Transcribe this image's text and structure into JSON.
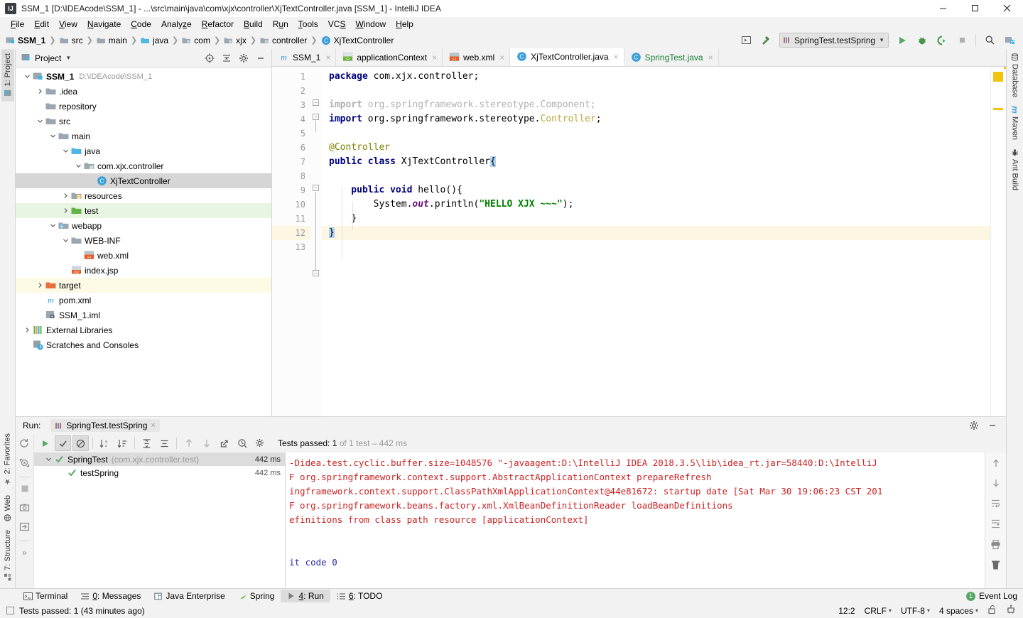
{
  "window": {
    "title": "SSM_1 [D:\\IDEAcode\\SSM_1] - ...\\src\\main\\java\\com\\xjx\\controller\\XjTextController.java [SSM_1] - IntelliJ IDEA",
    "icon": "intellij-logo-icon",
    "minimize_label": "Minimize",
    "maximize_label": "Maximize",
    "close_label": "Close"
  },
  "menubar": {
    "items": [
      {
        "label": "File",
        "mnemonic": "F"
      },
      {
        "label": "Edit",
        "mnemonic": "E"
      },
      {
        "label": "View",
        "mnemonic": "V"
      },
      {
        "label": "Navigate",
        "mnemonic": "N"
      },
      {
        "label": "Code",
        "mnemonic": "C"
      },
      {
        "label": "Analyze",
        "mnemonic": "z"
      },
      {
        "label": "Refactor",
        "mnemonic": "R"
      },
      {
        "label": "Build",
        "mnemonic": "B"
      },
      {
        "label": "Run",
        "mnemonic": "u"
      },
      {
        "label": "Tools",
        "mnemonic": "T"
      },
      {
        "label": "VCS",
        "mnemonic": "S"
      },
      {
        "label": "Window",
        "mnemonic": "W"
      },
      {
        "label": "Help",
        "mnemonic": "H"
      }
    ]
  },
  "navbar": {
    "breadcrumbs": [
      {
        "label": "SSM_1",
        "icon": "project-module-icon",
        "bold": true
      },
      {
        "label": "src",
        "icon": "folder-icon",
        "bold": false
      },
      {
        "label": "main",
        "icon": "folder-icon",
        "bold": false
      },
      {
        "label": "java",
        "icon": "source-folder-icon",
        "bold": false
      },
      {
        "label": "com",
        "icon": "package-icon",
        "bold": false
      },
      {
        "label": "xjx",
        "icon": "package-icon",
        "bold": false
      },
      {
        "label": "controller",
        "icon": "package-icon",
        "bold": false
      },
      {
        "label": "XjTextController",
        "icon": "java-class-icon",
        "bold": false
      }
    ],
    "separator": "›",
    "run_config": "SpringTest.testSpring",
    "buttons": [
      {
        "name": "select-run-configuration-icon",
        "title": "Select Run/Debug Configuration"
      },
      {
        "name": "build-hammer-icon",
        "title": "Build Project"
      },
      {
        "name": "run-button-icon",
        "title": "Run"
      },
      {
        "name": "debug-button-icon",
        "title": "Debug"
      },
      {
        "name": "run-with-coverage-icon",
        "title": "Run with Coverage"
      },
      {
        "name": "stop-button-icon",
        "title": "Stop"
      },
      {
        "name": "search-everywhere-icon",
        "title": "Search Everywhere"
      },
      {
        "name": "project-structure-icon",
        "title": "Project Structure"
      }
    ]
  },
  "left_stripe": {
    "top": [
      {
        "label": "1: Project",
        "mnemonic": "1",
        "active": true
      }
    ],
    "bottom": [
      {
        "label": "2: Favorites",
        "mnemonic": "2",
        "active": false
      },
      {
        "label": "Web",
        "mnemonic": "",
        "active": false
      },
      {
        "label": "7: Structure",
        "mnemonic": "7",
        "active": false
      }
    ]
  },
  "right_stripe": {
    "items": [
      {
        "label": "Database",
        "icon": "database-icon"
      },
      {
        "label": "Maven",
        "icon": "maven-icon"
      },
      {
        "label": "Ant Build",
        "icon": "ant-icon"
      }
    ]
  },
  "project_panel": {
    "title": "Project",
    "dropdown_caret": "▾",
    "actions": [
      {
        "name": "scroll-from-source-icon",
        "title": "Select Opened File"
      },
      {
        "name": "collapse-all-icon",
        "title": "Collapse All"
      },
      {
        "name": "settings-gear-icon",
        "title": "Settings"
      },
      {
        "name": "hide-panel-icon",
        "title": "Hide"
      }
    ],
    "tree": [
      {
        "label": "SSM_1",
        "path": "D:\\IDEAcode\\SSM_1",
        "depth": 0,
        "arrow": "down",
        "icon": "project-root-icon",
        "bold": true,
        "state": "none"
      },
      {
        "label": ".idea",
        "path": "",
        "depth": 1,
        "arrow": "right",
        "icon": "folder-icon",
        "bold": false,
        "state": "none"
      },
      {
        "label": "repository",
        "path": "",
        "depth": 1,
        "arrow": "none",
        "icon": "folder-icon",
        "bold": false,
        "state": "none"
      },
      {
        "label": "src",
        "path": "",
        "depth": 1,
        "arrow": "down",
        "icon": "folder-icon",
        "bold": false,
        "state": "none"
      },
      {
        "label": "main",
        "path": "",
        "depth": 2,
        "arrow": "down",
        "icon": "folder-icon",
        "bold": false,
        "state": "none"
      },
      {
        "label": "java",
        "path": "",
        "depth": 3,
        "arrow": "down",
        "icon": "source-folder-icon",
        "bold": false,
        "state": "none"
      },
      {
        "label": "com.xjx.controller",
        "path": "",
        "depth": 4,
        "arrow": "down",
        "icon": "package-icon",
        "bold": false,
        "state": "none"
      },
      {
        "label": "XjTextController",
        "path": "",
        "depth": 5,
        "arrow": "none",
        "icon": "java-class-icon",
        "bold": false,
        "state": "selected"
      },
      {
        "label": "resources",
        "path": "",
        "depth": 3,
        "arrow": "right",
        "icon": "resource-folder-icon",
        "bold": false,
        "state": "none"
      },
      {
        "label": "test",
        "path": "",
        "depth": 3,
        "arrow": "right",
        "icon": "test-folder-icon",
        "bold": false,
        "state": "green"
      },
      {
        "label": "webapp",
        "path": "",
        "depth": 2,
        "arrow": "down",
        "icon": "web-folder-icon",
        "bold": false,
        "state": "none"
      },
      {
        "label": "WEB-INF",
        "path": "",
        "depth": 3,
        "arrow": "down",
        "icon": "folder-icon",
        "bold": false,
        "state": "none"
      },
      {
        "label": "web.xml",
        "path": "",
        "depth": 4,
        "arrow": "none",
        "icon": "xml-file-icon",
        "bold": false,
        "state": "none"
      },
      {
        "label": "index.jsp",
        "path": "",
        "depth": 3,
        "arrow": "none",
        "icon": "jsp-file-icon",
        "bold": false,
        "state": "none"
      },
      {
        "label": "target",
        "path": "",
        "depth": 1,
        "arrow": "right",
        "icon": "excluded-folder-icon",
        "bold": false,
        "state": "yellowish"
      },
      {
        "label": "pom.xml",
        "path": "",
        "depth": 1,
        "arrow": "none",
        "icon": "maven-pom-icon",
        "bold": false,
        "state": "none"
      },
      {
        "label": "SSM_1.iml",
        "path": "",
        "depth": 1,
        "arrow": "none",
        "icon": "iml-file-icon",
        "bold": false,
        "state": "none"
      },
      {
        "label": "External Libraries",
        "path": "",
        "depth": 0,
        "arrow": "right",
        "icon": "libraries-icon",
        "bold": false,
        "state": "none"
      },
      {
        "label": "Scratches and Consoles",
        "path": "",
        "depth": 0,
        "arrow": "none",
        "icon": "scratches-icon",
        "bold": false,
        "state": "none"
      }
    ]
  },
  "editor": {
    "tabs": [
      {
        "label": "SSM_1",
        "icon": "maven-pom-icon",
        "active": false,
        "modified": false
      },
      {
        "label": "applicationContext",
        "icon": "spring-config-icon",
        "active": false,
        "modified": false
      },
      {
        "label": "web.xml",
        "icon": "xml-file-icon",
        "active": false,
        "modified": false
      },
      {
        "label": "XjTextController.java",
        "icon": "java-class-icon",
        "active": true,
        "modified": false
      },
      {
        "label": "SpringTest.java",
        "icon": "java-class-icon",
        "active": false,
        "modified": true
      }
    ],
    "close_glyph": "×",
    "line_numbers": [
      "1",
      "2",
      "3",
      "4",
      "5",
      "6",
      "7",
      "8",
      "9",
      "10",
      "11",
      "12",
      "13"
    ],
    "highlighted_line": 12,
    "lines": [
      {
        "n": 1,
        "tokens": [
          {
            "t": "package ",
            "c": "kw"
          },
          {
            "t": "com.xjx.controller;",
            "c": "plain"
          }
        ]
      },
      {
        "n": 2,
        "tokens": []
      },
      {
        "n": 3,
        "tokens": [
          {
            "t": "import ",
            "c": "kw-dim"
          },
          {
            "t": "org.springframework.stereotype.Component;",
            "c": "dim"
          }
        ]
      },
      {
        "n": 4,
        "tokens": [
          {
            "t": "import ",
            "c": "kw"
          },
          {
            "t": "org.springframework.stereotype.",
            "c": "plain"
          },
          {
            "t": "Controller",
            "c": "cls"
          },
          {
            "t": ";",
            "c": "plain"
          }
        ]
      },
      {
        "n": 5,
        "tokens": []
      },
      {
        "n": 6,
        "tokens": [
          {
            "t": "@Controller",
            "c": "ann"
          }
        ]
      },
      {
        "n": 7,
        "tokens": [
          {
            "t": "public class ",
            "c": "kw"
          },
          {
            "t": "XjTextController",
            "c": "plain"
          },
          {
            "t": "{",
            "c": "match"
          }
        ]
      },
      {
        "n": 8,
        "tokens": []
      },
      {
        "n": 9,
        "tokens": [
          {
            "t": "    public void ",
            "c": "kw"
          },
          {
            "t": "hello(){",
            "c": "plain"
          }
        ]
      },
      {
        "n": 10,
        "tokens": [
          {
            "t": "        System.",
            "c": "plain"
          },
          {
            "t": "out",
            "c": "fld"
          },
          {
            "t": ".println(",
            "c": "plain"
          },
          {
            "t": "\"HELLO XJX ~~~\"",
            "c": "str"
          },
          {
            "t": ");",
            "c": "plain"
          }
        ]
      },
      {
        "n": 11,
        "tokens": [
          {
            "t": "    }",
            "c": "plain"
          }
        ]
      },
      {
        "n": 12,
        "tokens": [
          {
            "t": "}",
            "c": "match"
          }
        ]
      },
      {
        "n": 13,
        "tokens": []
      }
    ]
  },
  "run_panel": {
    "label": "Run:",
    "tab_title": "SpringTest.testSpring",
    "close_glyph": "×",
    "header_actions": [
      {
        "name": "settings-gear-icon",
        "title": "Settings"
      },
      {
        "name": "hide-panel-icon",
        "title": "Hide"
      }
    ],
    "left_icons": [
      {
        "name": "rerun-icon",
        "title": "Rerun"
      },
      {
        "name": "rerun-failed-tests-icon",
        "title": "Rerun Failed Tests"
      },
      {
        "name": "stop-icon",
        "title": "Stop"
      },
      {
        "name": "dump-threads-icon",
        "title": "Dump Threads"
      },
      {
        "name": "restore-layout-icon",
        "title": "Restore Layout"
      },
      {
        "name": "more-icon",
        "title": "More"
      }
    ],
    "toolbar": [
      {
        "name": "run-green-icon",
        "title": "Run",
        "toggled": false
      },
      {
        "name": "show-passed-icon",
        "title": "Show Passed",
        "toggled": true
      },
      {
        "name": "show-ignored-icon",
        "title": "Show Ignored",
        "toggled": true
      },
      {
        "name": "sort-alphabetically-icon",
        "title": "Sort Alphabetically",
        "toggled": false
      },
      {
        "name": "sort-by-duration-icon",
        "title": "Sort by Duration",
        "toggled": false
      },
      {
        "name": "expand-all-icon",
        "title": "Expand All",
        "toggled": false
      },
      {
        "name": "collapse-all-icon",
        "title": "Collapse All",
        "toggled": false
      },
      {
        "name": "prev-failed-icon",
        "title": "Previous Failed Test",
        "toggled": false
      },
      {
        "name": "next-failed-icon",
        "title": "Next Failed Test",
        "toggled": false
      },
      {
        "name": "export-results-icon",
        "title": "Export Test Results",
        "toggled": false
      },
      {
        "name": "test-history-icon",
        "title": "Test History",
        "toggled": false
      },
      {
        "name": "test-settings-icon",
        "title": "Settings",
        "toggled": false
      }
    ],
    "status": {
      "prefix": "Tests passed:",
      "count": "1",
      "suffix": "of 1 test – 442 ms"
    },
    "tests": [
      {
        "label": "SpringTest",
        "package": "(com.xjx.controller.test)",
        "time": "442 ms",
        "depth": 0,
        "arrow": "down",
        "selected": true
      },
      {
        "label": "testSpring",
        "package": "",
        "time": "442 ms",
        "depth": 1,
        "arrow": "none",
        "selected": false
      }
    ],
    "console_lines": [
      {
        "text": "-Didea.test.cyclic.buffer.size=1048576 \"-javaagent:D:\\IntelliJ IDEA 2018.3.5\\lib\\idea_rt.jar=58440:D:\\IntelliJ",
        "color": "red"
      },
      {
        "text": "F org.springframework.context.support.AbstractApplicationContext prepareRefresh",
        "color": "red"
      },
      {
        "text": "ingframework.context.support.ClassPathXmlApplicationContext@44e81672: startup date [Sat Mar 30 19:06:23 CST 201",
        "color": "red"
      },
      {
        "text": "F org.springframework.beans.factory.xml.XmlBeanDefinitionReader loadBeanDefinitions",
        "color": "red"
      },
      {
        "text": "efinitions from class path resource [applicationContext]",
        "color": "red"
      },
      {
        "text": "",
        "color": "black"
      },
      {
        "text": "",
        "color": "black"
      },
      {
        "text": "it code 0",
        "color": "blue"
      }
    ],
    "console_right_icons": [
      {
        "name": "scroll-up-icon",
        "title": "Up"
      },
      {
        "name": "scroll-down-icon",
        "title": "Down"
      },
      {
        "name": "soft-wrap-icon",
        "title": "Soft-Wrap"
      },
      {
        "name": "scroll-to-end-icon",
        "title": "Scroll to End"
      },
      {
        "name": "print-icon",
        "title": "Print"
      },
      {
        "name": "clear-all-icon",
        "title": "Clear All"
      }
    ]
  },
  "bottom_bar": {
    "items": [
      {
        "label": "Terminal",
        "mnemonic": "",
        "icon": "terminal-icon",
        "active": false
      },
      {
        "label": "0: Messages",
        "mnemonic": "0",
        "icon": "messages-icon",
        "active": false
      },
      {
        "label": "Java Enterprise",
        "mnemonic": "",
        "icon": "java-enterprise-icon",
        "active": false
      },
      {
        "label": "Spring",
        "mnemonic": "",
        "icon": "spring-leaf-icon",
        "active": false
      },
      {
        "label": "4: Run",
        "mnemonic": "4",
        "icon": "run-icon",
        "active": true
      },
      {
        "label": "6: TODO",
        "mnemonic": "6",
        "icon": "todo-icon",
        "active": false
      }
    ],
    "event_log": {
      "label": "Event Log",
      "badge": "1"
    }
  },
  "status_bar": {
    "message": "Tests passed: 1 (43 minutes ago)",
    "caret_position": "12:2",
    "line_separator": "CRLF",
    "encoding": "UTF-8",
    "indent": "4 spaces",
    "caret_glyph": "↕",
    "lock_icon": "unlocked-icon",
    "inspection_icon": "inspections-icon"
  }
}
